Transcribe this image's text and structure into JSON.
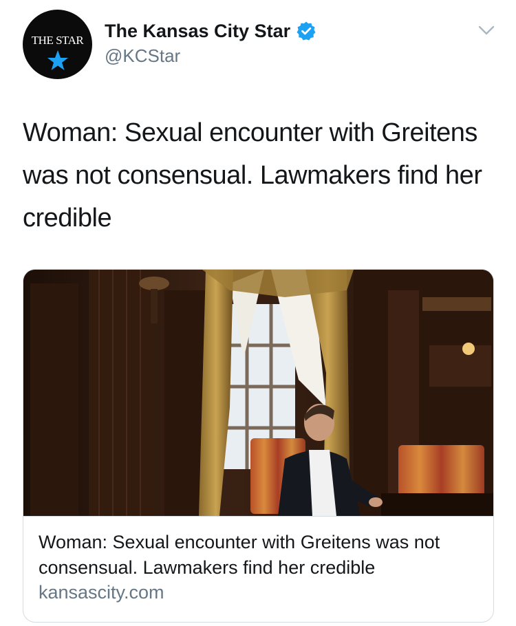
{
  "account": {
    "display_name": "The Kansas City Star",
    "handle": "@KCStar",
    "avatar_logo_text": "THE STAR"
  },
  "icons": {
    "verified": "verified-badge-icon",
    "menu": "chevron-down-icon",
    "avatar_star": "star-icon"
  },
  "tweet": {
    "text": "Woman: Sexual encounter with Greitens was not consensual. Lawmakers find her credible"
  },
  "card": {
    "image_description_icon": "article-photo",
    "title": "Woman: Sexual encounter with Greitens was not consensual. Lawmakers find her credible",
    "domain": "kansascity.com"
  },
  "colors": {
    "text": "#14171a",
    "secondary": "#657786",
    "verified": "#1da1f2",
    "avatar_star": "#1da1f2",
    "card_border": "#d5dbe0"
  }
}
